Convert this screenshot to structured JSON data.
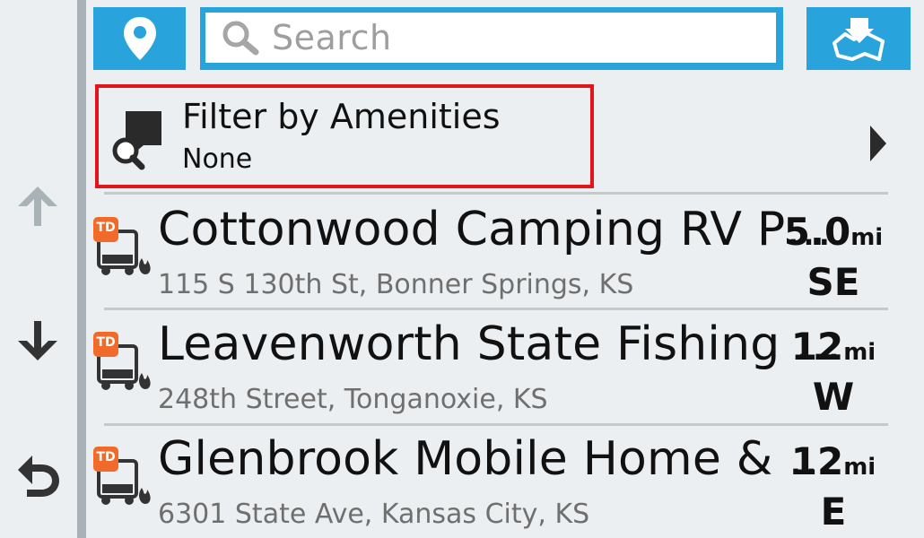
{
  "search": {
    "placeholder": "Search"
  },
  "filter": {
    "title": "Filter by Amenities",
    "value": "None"
  },
  "results": [
    {
      "name": "Cottonwood Camping RV P…",
      "address": "115 S 130th St, Bonner Springs, KS",
      "distance": "5.0",
      "unit": "mi",
      "direction": "SE",
      "badge": "TD"
    },
    {
      "name": "Leavenworth State Fishing …",
      "address": "248th Street, Tonganoxie, KS",
      "distance": "12",
      "unit": "mi",
      "direction": "W",
      "badge": "TD"
    },
    {
      "name": "Glenbrook Mobile Home & …",
      "address": "6301 State Ave, Kansas City, KS",
      "distance": "12",
      "unit": "mi",
      "direction": "E",
      "badge": "TD"
    }
  ],
  "icons": {
    "location": "map-pin-icon",
    "search": "magnifier-icon",
    "map": "map-view-icon",
    "filter": "amenity-filter-icon",
    "up": "arrow-up-icon",
    "down": "arrow-down-icon",
    "back": "back-icon",
    "chevron": "chevron-right-icon"
  },
  "colors": {
    "accent": "#29a3dc",
    "highlight": "#e3141b",
    "badge": "#f06a2a"
  }
}
